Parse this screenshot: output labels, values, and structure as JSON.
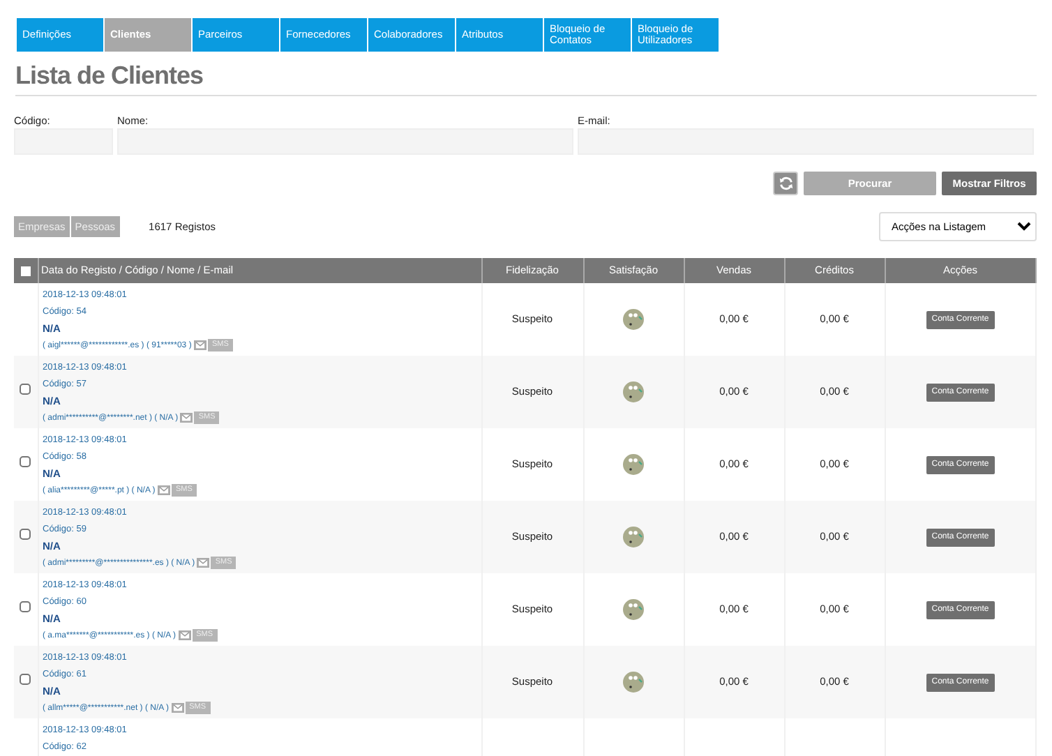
{
  "tabs": [
    {
      "label": "Definições",
      "selected": false
    },
    {
      "label": "Clientes",
      "selected": true
    },
    {
      "label": "Parceiros",
      "selected": false
    },
    {
      "label": "Fornecedores",
      "selected": false
    },
    {
      "label": "Colaboradores",
      "selected": false
    },
    {
      "label": "Atributos",
      "selected": false
    },
    {
      "label": "Bloqueio de Contatos",
      "selected": false
    },
    {
      "label": "Bloqueio de Utilizadores",
      "selected": false
    }
  ],
  "title": "Lista de Clientes",
  "filters": [
    {
      "label": "Código:"
    },
    {
      "label": "Nome:"
    },
    {
      "label": "E-mail:"
    }
  ],
  "buttons": {
    "search": "Procurar",
    "show_filters": "Mostrar Filtros"
  },
  "type_buttons": [
    "Empresas",
    "Pessoas"
  ],
  "record_count": "1617 Registos",
  "actions_select": "Acções na Listagem",
  "table": {
    "columns": [
      "Data do Registo / Código / Nome / E-mail",
      "Fidelização",
      "Satisfação",
      "Vendas",
      "Créditos",
      "Acções"
    ],
    "rows": [
      {
        "selectable": false,
        "date": "2018-12-13 09:48:01",
        "code": "Código: 54",
        "name": "N/A",
        "contact": "( aigl******@************.es ) ( 91*****03 )",
        "sms": "SMS",
        "loyalty": "Suspeito",
        "sales": "0,00 €",
        "credits": "0,00 €",
        "action": "Conta Corrente"
      },
      {
        "selectable": true,
        "checked": false,
        "date": "2018-12-13 09:48:01",
        "code": "Código: 57",
        "name": "N/A",
        "contact": "( admi**********@********.net ) ( N/A )",
        "sms": "SMS",
        "loyalty": "Suspeito",
        "sales": "0,00 €",
        "credits": "0,00 €",
        "action": "Conta Corrente"
      },
      {
        "selectable": true,
        "checked": false,
        "date": "2018-12-13 09:48:01",
        "code": "Código: 58",
        "name": "N/A",
        "contact": "( alia*********@*****.pt ) ( N/A )",
        "sms": "SMS",
        "loyalty": "Suspeito",
        "sales": "0,00 €",
        "credits": "0,00 €",
        "action": "Conta Corrente"
      },
      {
        "selectable": true,
        "checked": false,
        "date": "2018-12-13 09:48:01",
        "code": "Código: 59",
        "name": "N/A",
        "contact": "( admi*********@***************.es ) ( N/A )",
        "sms": "SMS",
        "loyalty": "Suspeito",
        "sales": "0,00 €",
        "credits": "0,00 €",
        "action": "Conta Corrente"
      },
      {
        "selectable": true,
        "checked": false,
        "date": "2018-12-13 09:48:01",
        "code": "Código: 60",
        "name": "N/A",
        "contact": "( a.ma*******@***********.es ) ( N/A )",
        "sms": "SMS",
        "loyalty": "Suspeito",
        "sales": "0,00 €",
        "credits": "0,00 €",
        "action": "Conta Corrente"
      },
      {
        "selectable": true,
        "checked": false,
        "date": "2018-12-13 09:48:01",
        "code": "Código: 61",
        "name": "N/A",
        "contact": "( allm*****@***********.net ) ( N/A )",
        "sms": "SMS",
        "loyalty": "Suspeito",
        "sales": "0,00 €",
        "credits": "0,00 €",
        "action": "Conta Corrente"
      },
      {
        "date": "2018-12-13 09:48:01",
        "code": "Código: 62"
      }
    ],
    "select_all_checked": false
  }
}
